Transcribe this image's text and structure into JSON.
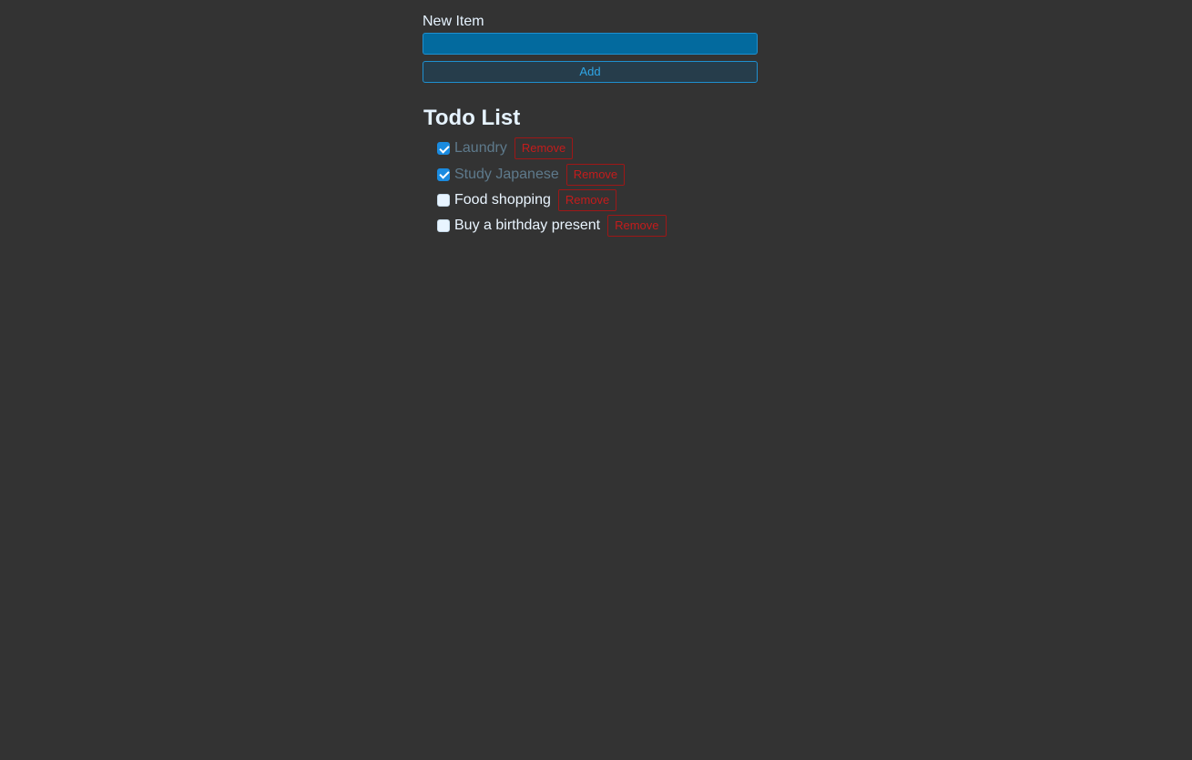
{
  "form": {
    "label": "New Item",
    "input_value": "",
    "input_placeholder": "",
    "add_label": "Add"
  },
  "list": {
    "title": "Todo List",
    "items": [
      {
        "text": "Laundry",
        "done": true,
        "remove_label": "Remove"
      },
      {
        "text": "Study Japanese",
        "done": true,
        "remove_label": "Remove"
      },
      {
        "text": "Food shopping",
        "done": false,
        "remove_label": "Remove"
      },
      {
        "text": "Buy a birthday present",
        "done": false,
        "remove_label": "Remove"
      }
    ]
  },
  "colors": {
    "background": "#333333",
    "input_fill": "#036a9e",
    "accent_blue": "#1e90d0",
    "remove_red": "#c41c1c",
    "done_text": "#5e7a8c"
  }
}
